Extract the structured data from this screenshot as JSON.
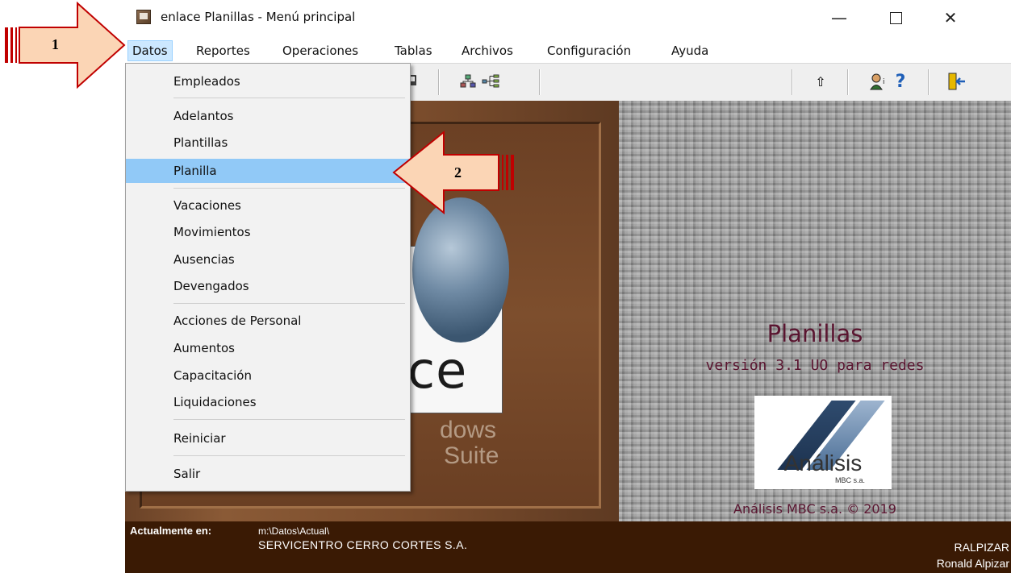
{
  "window": {
    "title": "enlace Planillas - Menú principal",
    "controls": {
      "minimize": "—",
      "maximize": "",
      "close": "✕"
    }
  },
  "menubar": {
    "items": [
      "Datos",
      "Reportes",
      "Operaciones",
      "Tablas",
      "Archivos",
      "Configuración",
      "Ayuda"
    ]
  },
  "dropdown": {
    "items": [
      "Empleados",
      "Adelantos",
      "Plantillas",
      "Planilla",
      "Vacaciones",
      "Movimientos",
      "Ausencias",
      "Devengados",
      "Acciones de Personal",
      "Aumentos",
      "Capacitación",
      "Liquidaciones",
      "Reiniciar",
      "Salir"
    ],
    "selected": "Planilla"
  },
  "toolbar": {
    "icons": [
      "print-icon",
      "org-chart-icon",
      "tree-icon",
      "up-arrow-icon",
      "user-help-icon",
      "question-icon",
      "exit-door-icon"
    ]
  },
  "splash": {
    "logo_text": "ce",
    "logo_windows": "dows",
    "logo_suite": "Suite",
    "product_name": "Planillas",
    "product_version": "versión 3.1 UO para redes",
    "brand_name": "Análisis",
    "brand_sub": "MBC s.a.",
    "copyright": "Análisis MBC s.a. © 2019"
  },
  "status": {
    "label": "Actualmente en:",
    "path": "m:\\Datos\\Actual\\",
    "company": "SERVICENTRO CERRO CORTES S.A.",
    "user": "RALPIZAR",
    "user_name": "Ronald Alpizar"
  },
  "callouts": {
    "first": "1",
    "second": "2"
  },
  "colors": {
    "callout_fill": "#fbd5b5",
    "callout_stroke": "#c00000",
    "selected_item": "#91c9f7",
    "status_bg": "#3a1a04",
    "product_text": "#5a1530"
  }
}
